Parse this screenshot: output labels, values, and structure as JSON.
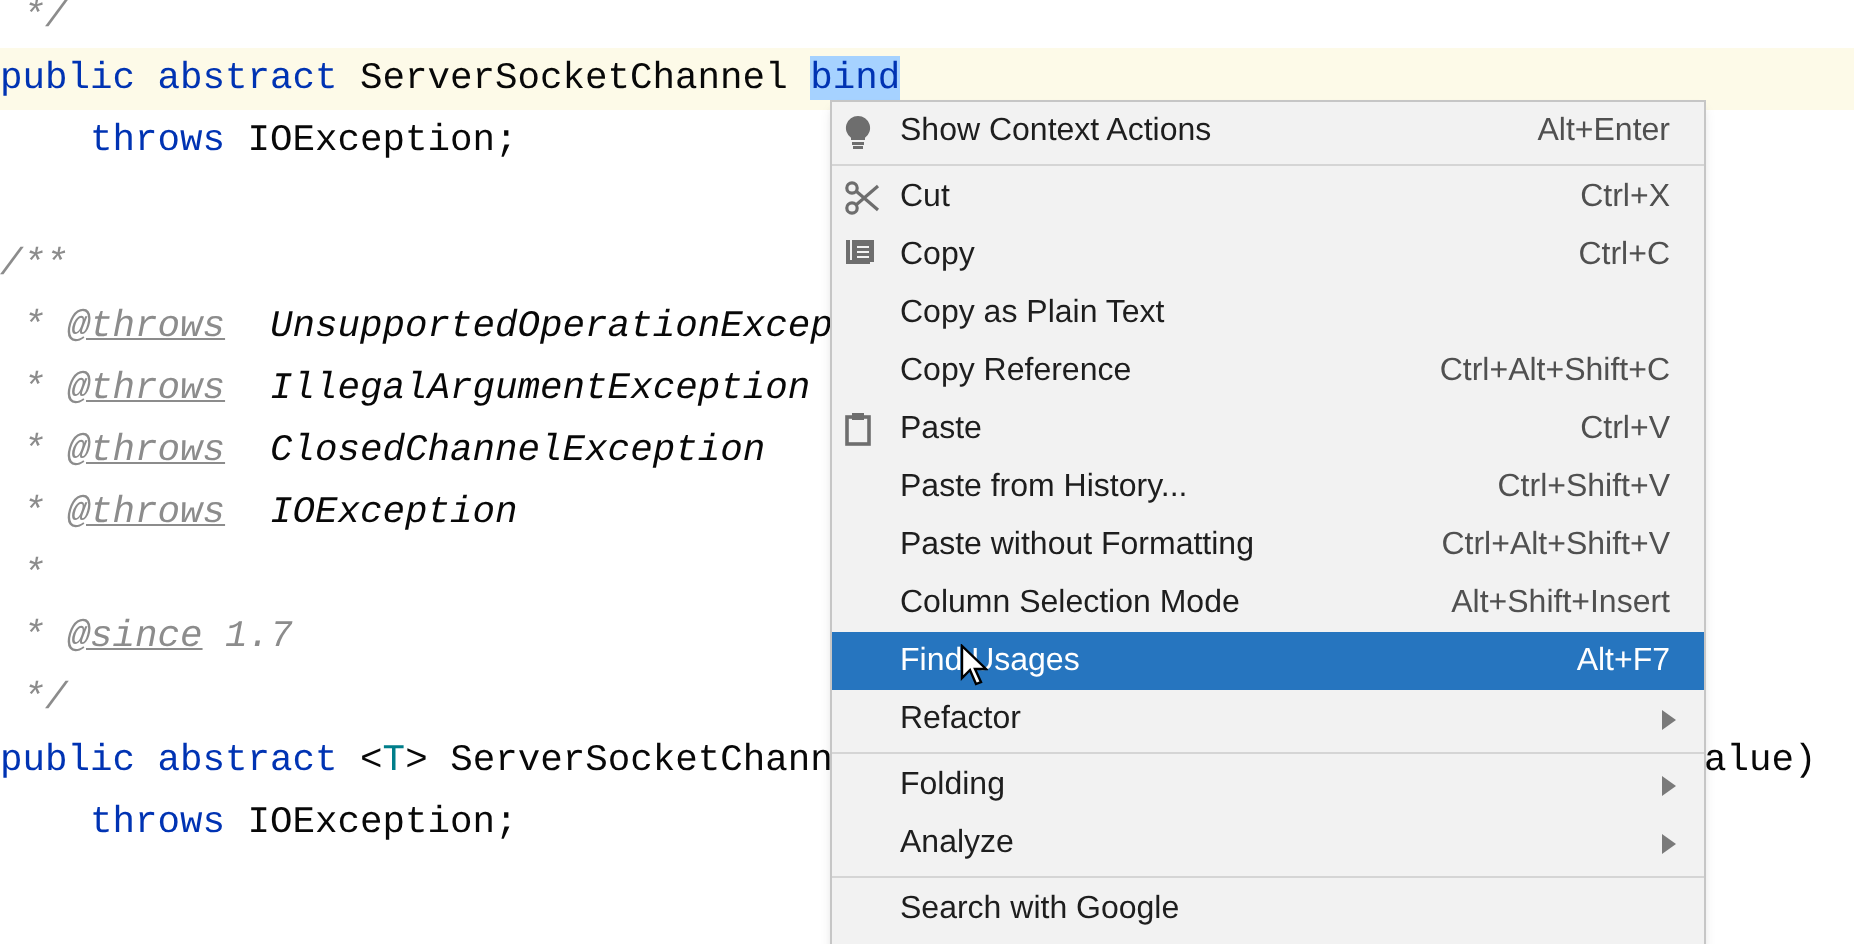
{
  "code_lines": [
    {
      "tokens": [
        {
          "kind": "comment",
          "text": " */"
        }
      ]
    },
    {
      "caret_line": true,
      "tokens": [
        {
          "kind": "keyword",
          "text": "public abstract "
        },
        {
          "kind": "plain",
          "text": "ServerSocketChannel "
        },
        {
          "kind": "selected",
          "text": "bind"
        }
      ]
    },
    {
      "tokens": [
        {
          "kind": "keyword",
          "text": "    throws"
        },
        {
          "kind": "plain",
          "text": " IOException;"
        }
      ]
    },
    {
      "blank_before": true,
      "tokens": [
        {
          "kind": "comment",
          "text": "/**"
        }
      ]
    },
    {
      "tokens": [
        {
          "kind": "comment",
          "text": " * "
        },
        {
          "kind": "tag",
          "text": "@throws"
        },
        {
          "kind": "doc_type",
          "text": "  UnsupportedOperationExcep"
        }
      ]
    },
    {
      "tokens": [
        {
          "kind": "comment",
          "text": " * "
        },
        {
          "kind": "tag",
          "text": "@throws"
        },
        {
          "kind": "doc_type",
          "text": "  IllegalArgumentException"
        }
      ]
    },
    {
      "tokens": [
        {
          "kind": "comment",
          "text": " * "
        },
        {
          "kind": "tag",
          "text": "@throws"
        },
        {
          "kind": "doc_type",
          "text": "  ClosedChannelException"
        }
      ]
    },
    {
      "tokens": [
        {
          "kind": "comment",
          "text": " * "
        },
        {
          "kind": "tag",
          "text": "@throws"
        },
        {
          "kind": "doc_type",
          "text": "  IOException"
        }
      ]
    },
    {
      "tokens": [
        {
          "kind": "comment",
          "text": " *"
        }
      ]
    },
    {
      "tokens": [
        {
          "kind": "comment",
          "text": " * "
        },
        {
          "kind": "tag",
          "text": "@since"
        },
        {
          "kind": "comment",
          "text": " 1.7"
        }
      ]
    },
    {
      "tokens": [
        {
          "kind": "comment",
          "text": " */"
        }
      ]
    },
    {
      "tokens": [
        {
          "kind": "keyword",
          "text": "public abstract "
        },
        {
          "kind": "plain",
          "text": "<"
        },
        {
          "kind": "type_param",
          "text": "T"
        },
        {
          "kind": "plain",
          "text": "> ServerSocketChann"
        }
      ],
      "tail": "alue)"
    },
    {
      "tokens": [
        {
          "kind": "keyword",
          "text": "    throws"
        },
        {
          "kind": "plain",
          "text": " IOException;"
        }
      ]
    }
  ],
  "context_menu": {
    "groups": [
      [
        {
          "label": "Show Context Actions",
          "shortcut": "Alt+Enter",
          "kind": "action",
          "selected": false
        }
      ],
      [
        {
          "label": "Cut",
          "shortcut": "Ctrl+X",
          "kind": "action",
          "selected": false
        },
        {
          "label": "Copy",
          "shortcut": "Ctrl+C",
          "kind": "action",
          "selected": false
        },
        {
          "label": "Copy as Plain Text",
          "kind": "action",
          "selected": false
        },
        {
          "label": "Copy Reference",
          "shortcut": "Ctrl+Alt+Shift+C",
          "kind": "action",
          "selected": false
        },
        {
          "label": "Paste",
          "shortcut": "Ctrl+V",
          "kind": "action",
          "selected": false
        },
        {
          "label": "Paste from History...",
          "shortcut": "Ctrl+Shift+V",
          "kind": "action",
          "selected": false
        },
        {
          "label": "Paste without Formatting",
          "shortcut": "Ctrl+Alt+Shift+V",
          "kind": "action",
          "selected": false
        },
        {
          "label": "Column Selection Mode",
          "shortcut": "Alt+Shift+Insert",
          "kind": "action",
          "selected": false
        },
        {
          "label": "Find Usages",
          "shortcut": "Alt+F7",
          "kind": "action",
          "selected": true
        },
        {
          "label": "Refactor",
          "kind": "submenu",
          "selected": false
        }
      ],
      [
        {
          "label": "Folding",
          "kind": "submenu",
          "selected": false
        },
        {
          "label": "Analyze",
          "kind": "submenu",
          "selected": false
        }
      ],
      [
        {
          "label": "Search with Google",
          "kind": "action",
          "selected": false
        }
      ]
    ]
  }
}
